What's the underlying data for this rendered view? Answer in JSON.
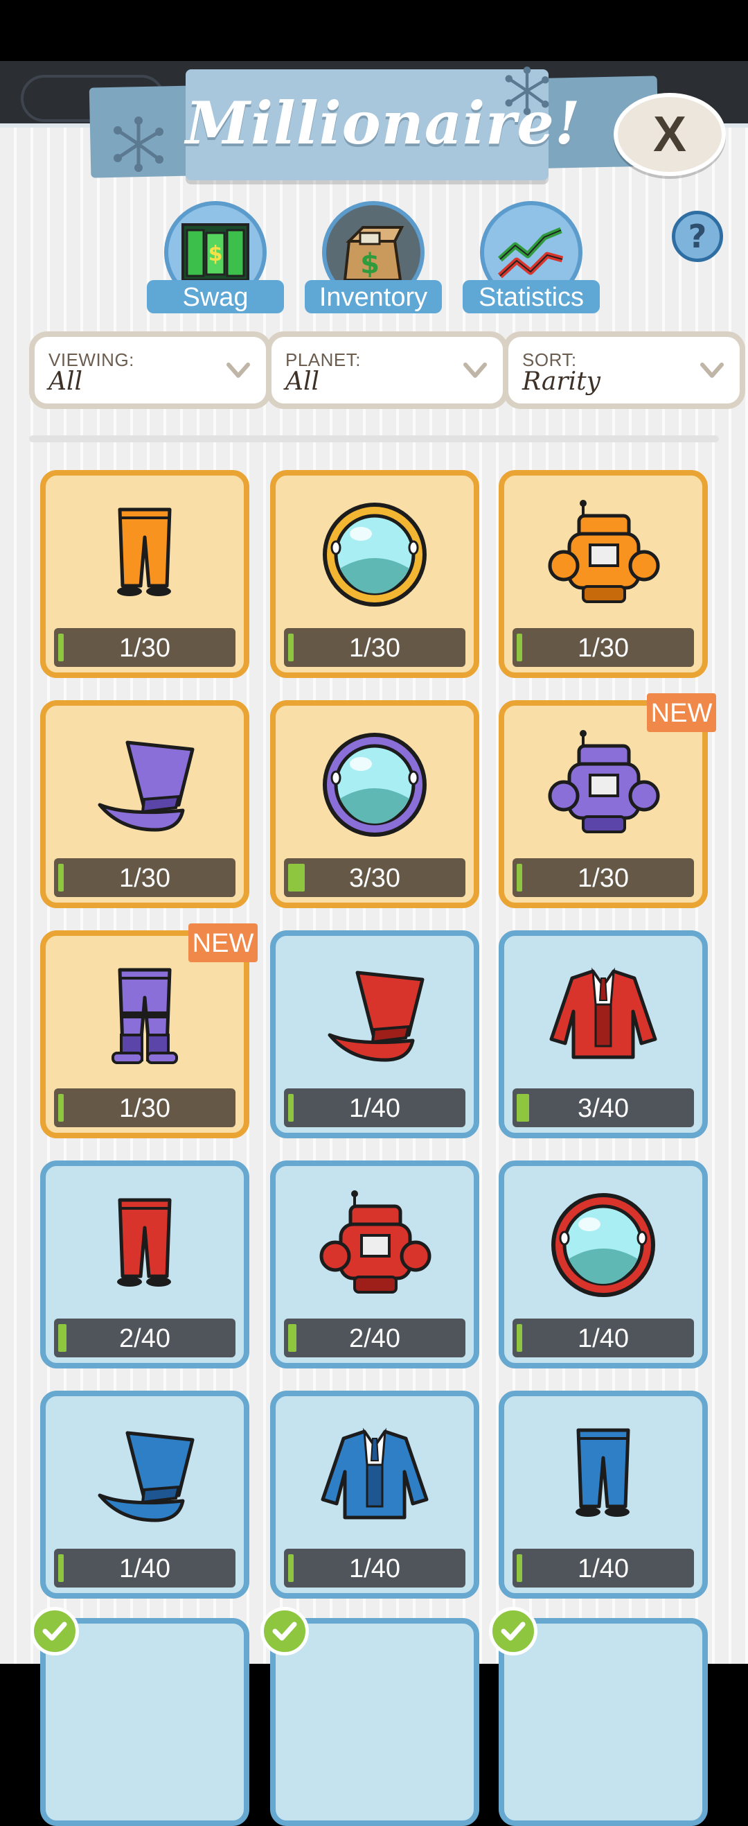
{
  "title": "Millionaire!",
  "close_label": "X",
  "tabs": [
    {
      "label": "Swag",
      "icon": "money-doors-icon"
    },
    {
      "label": "Inventory",
      "icon": "cash-box-icon"
    },
    {
      "label": "Statistics",
      "icon": "chart-arrows-icon"
    }
  ],
  "help_label": "?",
  "filters": {
    "viewing": {
      "label": "VIEWING:",
      "value": "All"
    },
    "planet": {
      "label": "PLANET:",
      "value": "All"
    },
    "sort": {
      "label": "SORT:",
      "value": "Rarity"
    }
  },
  "new_label": "NEW",
  "items": [
    {
      "name": "orange-pants",
      "count": "1/30",
      "owned": 1,
      "max": 30,
      "rarity": "gold",
      "new": false
    },
    {
      "name": "gold-porthole-helmet",
      "count": "1/30",
      "owned": 1,
      "max": 30,
      "rarity": "gold",
      "new": false
    },
    {
      "name": "orange-robot-suit",
      "count": "1/30",
      "owned": 1,
      "max": 30,
      "rarity": "gold",
      "new": false
    },
    {
      "name": "purple-top-hat",
      "count": "1/30",
      "owned": 1,
      "max": 30,
      "rarity": "gold",
      "new": false
    },
    {
      "name": "purple-porthole-helmet",
      "count": "3/30",
      "owned": 3,
      "max": 30,
      "rarity": "gold",
      "new": false
    },
    {
      "name": "purple-robot-suit",
      "count": "1/30",
      "owned": 1,
      "max": 30,
      "rarity": "gold",
      "new": true
    },
    {
      "name": "purple-boot-pants",
      "count": "1/30",
      "owned": 1,
      "max": 30,
      "rarity": "gold",
      "new": true
    },
    {
      "name": "red-top-hat",
      "count": "1/40",
      "owned": 1,
      "max": 40,
      "rarity": "blue",
      "new": false
    },
    {
      "name": "red-tuxedo-jacket",
      "count": "3/40",
      "owned": 3,
      "max": 40,
      "rarity": "blue",
      "new": false
    },
    {
      "name": "red-pants",
      "count": "2/40",
      "owned": 2,
      "max": 40,
      "rarity": "blue",
      "new": false
    },
    {
      "name": "red-robot-suit",
      "count": "2/40",
      "owned": 2,
      "max": 40,
      "rarity": "blue",
      "new": false
    },
    {
      "name": "red-porthole-helmet",
      "count": "1/40",
      "owned": 1,
      "max": 40,
      "rarity": "blue",
      "new": false
    },
    {
      "name": "blue-top-hat",
      "count": "1/40",
      "owned": 1,
      "max": 40,
      "rarity": "blue",
      "new": false
    },
    {
      "name": "blue-tuxedo-jacket",
      "count": "1/40",
      "owned": 1,
      "max": 40,
      "rarity": "blue",
      "new": false
    },
    {
      "name": "blue-pants",
      "count": "1/40",
      "owned": 1,
      "max": 40,
      "rarity": "blue",
      "new": false
    }
  ],
  "colors": {
    "gold_card": "#f9dfa7",
    "gold_border": "#eaa434",
    "blue_card": "#c5e2ef",
    "blue_border": "#66a8cf",
    "progress": "#8ec63f",
    "new_badge": "#f0884a"
  }
}
